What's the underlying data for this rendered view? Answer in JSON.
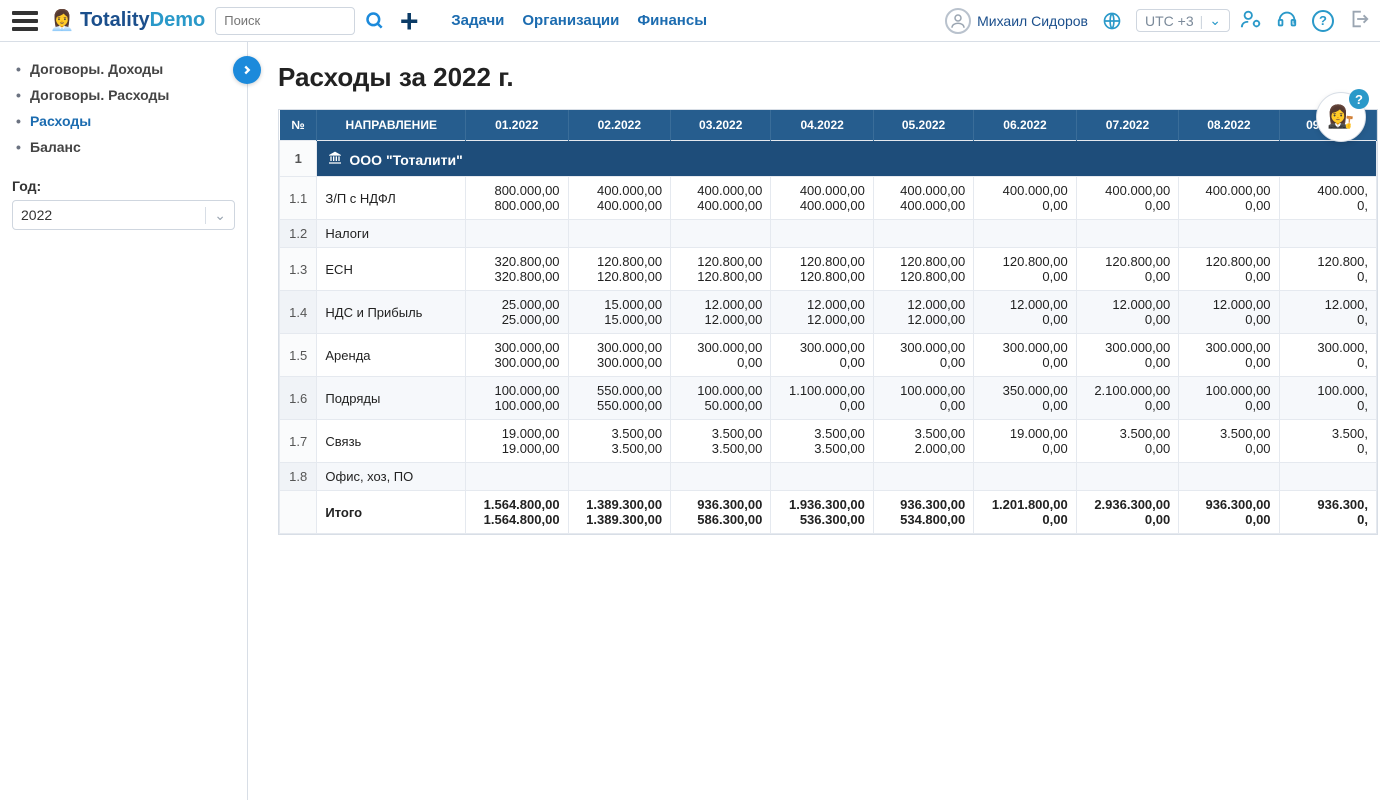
{
  "header": {
    "brand_main": "Totality",
    "brand_sub": "Demo",
    "search_placeholder": "Поиск",
    "nav": [
      "Задачи",
      "Организации",
      "Финансы"
    ],
    "user": "Михаил Сидоров",
    "tz": "UTC +3"
  },
  "sidebar": {
    "items": [
      {
        "label": "Договоры. Доходы"
      },
      {
        "label": "Договоры. Расходы"
      },
      {
        "label": "Расходы"
      },
      {
        "label": "Баланс"
      }
    ],
    "year_label": "Год:",
    "year_value": "2022"
  },
  "page_title": "Расходы за 2022 г.",
  "table": {
    "columns": [
      "№",
      "НАПРАВЛЕНИЕ",
      "01.2022",
      "02.2022",
      "03.2022",
      "04.2022",
      "05.2022",
      "06.2022",
      "07.2022",
      "08.2022",
      "09.2022"
    ],
    "org_row": {
      "num": "1",
      "name": "ООО \"Тоталити\""
    },
    "rows": [
      {
        "num": "1.1",
        "dir": "З/П с НДФЛ",
        "vals": [
          [
            "800.000,00",
            "800.000,00"
          ],
          [
            "400.000,00",
            "400.000,00"
          ],
          [
            "400.000,00",
            "400.000,00"
          ],
          [
            "400.000,00",
            "400.000,00"
          ],
          [
            "400.000,00",
            "400.000,00"
          ],
          [
            "400.000,00",
            "0,00"
          ],
          [
            "400.000,00",
            "0,00"
          ],
          [
            "400.000,00",
            "0,00"
          ],
          [
            "400.000,",
            "0,"
          ]
        ]
      },
      {
        "num": "1.2",
        "dir": "Налоги",
        "vals": [
          [
            "",
            ""
          ],
          [
            "",
            ""
          ],
          [
            "",
            ""
          ],
          [
            "",
            ""
          ],
          [
            "",
            ""
          ],
          [
            "",
            ""
          ],
          [
            "",
            ""
          ],
          [
            "",
            ""
          ],
          [
            "",
            ""
          ]
        ]
      },
      {
        "num": "1.3",
        "dir": "ЕСН",
        "vals": [
          [
            "320.800,00",
            "320.800,00"
          ],
          [
            "120.800,00",
            "120.800,00"
          ],
          [
            "120.800,00",
            "120.800,00"
          ],
          [
            "120.800,00",
            "120.800,00"
          ],
          [
            "120.800,00",
            "120.800,00"
          ],
          [
            "120.800,00",
            "0,00"
          ],
          [
            "120.800,00",
            "0,00"
          ],
          [
            "120.800,00",
            "0,00"
          ],
          [
            "120.800,",
            "0,"
          ]
        ]
      },
      {
        "num": "1.4",
        "dir": "НДС и Прибыль",
        "vals": [
          [
            "25.000,00",
            "25.000,00"
          ],
          [
            "15.000,00",
            "15.000,00"
          ],
          [
            "12.000,00",
            "12.000,00"
          ],
          [
            "12.000,00",
            "12.000,00"
          ],
          [
            "12.000,00",
            "12.000,00"
          ],
          [
            "12.000,00",
            "0,00"
          ],
          [
            "12.000,00",
            "0,00"
          ],
          [
            "12.000,00",
            "0,00"
          ],
          [
            "12.000,",
            "0,"
          ]
        ]
      },
      {
        "num": "1.5",
        "dir": "Аренда",
        "vals": [
          [
            "300.000,00",
            "300.000,00"
          ],
          [
            "300.000,00",
            "300.000,00"
          ],
          [
            "300.000,00",
            "0,00"
          ],
          [
            "300.000,00",
            "0,00"
          ],
          [
            "300.000,00",
            "0,00"
          ],
          [
            "300.000,00",
            "0,00"
          ],
          [
            "300.000,00",
            "0,00"
          ],
          [
            "300.000,00",
            "0,00"
          ],
          [
            "300.000,",
            "0,"
          ]
        ]
      },
      {
        "num": "1.6",
        "dir": "Подряды",
        "vals": [
          [
            "100.000,00",
            "100.000,00"
          ],
          [
            "550.000,00",
            "550.000,00"
          ],
          [
            "100.000,00",
            "50.000,00"
          ],
          [
            "1.100.000,00",
            "0,00"
          ],
          [
            "100.000,00",
            "0,00"
          ],
          [
            "350.000,00",
            "0,00"
          ],
          [
            "2.100.000,00",
            "0,00"
          ],
          [
            "100.000,00",
            "0,00"
          ],
          [
            "100.000,",
            "0,"
          ]
        ]
      },
      {
        "num": "1.7",
        "dir": "Связь",
        "vals": [
          [
            "19.000,00",
            "19.000,00"
          ],
          [
            "3.500,00",
            "3.500,00"
          ],
          [
            "3.500,00",
            "3.500,00"
          ],
          [
            "3.500,00",
            "3.500,00"
          ],
          [
            "3.500,00",
            "2.000,00"
          ],
          [
            "19.000,00",
            "0,00"
          ],
          [
            "3.500,00",
            "0,00"
          ],
          [
            "3.500,00",
            "0,00"
          ],
          [
            "3.500,",
            "0,"
          ]
        ]
      },
      {
        "num": "1.8",
        "dir": "Офис, хоз, ПО",
        "vals": [
          [
            "",
            ""
          ],
          [
            "",
            ""
          ],
          [
            "",
            ""
          ],
          [
            "",
            ""
          ],
          [
            "",
            ""
          ],
          [
            "",
            ""
          ],
          [
            "",
            ""
          ],
          [
            "",
            ""
          ],
          [
            "",
            ""
          ]
        ]
      }
    ],
    "totals": {
      "dir": "Итого",
      "vals": [
        [
          "1.564.800,00",
          "1.564.800,00"
        ],
        [
          "1.389.300,00",
          "1.389.300,00"
        ],
        [
          "936.300,00",
          "586.300,00"
        ],
        [
          "1.936.300,00",
          "536.300,00"
        ],
        [
          "936.300,00",
          "534.800,00"
        ],
        [
          "1.201.800,00",
          "0,00"
        ],
        [
          "2.936.300,00",
          "0,00"
        ],
        [
          "936.300,00",
          "0,00"
        ],
        [
          "936.300,",
          "0,"
        ]
      ]
    }
  }
}
